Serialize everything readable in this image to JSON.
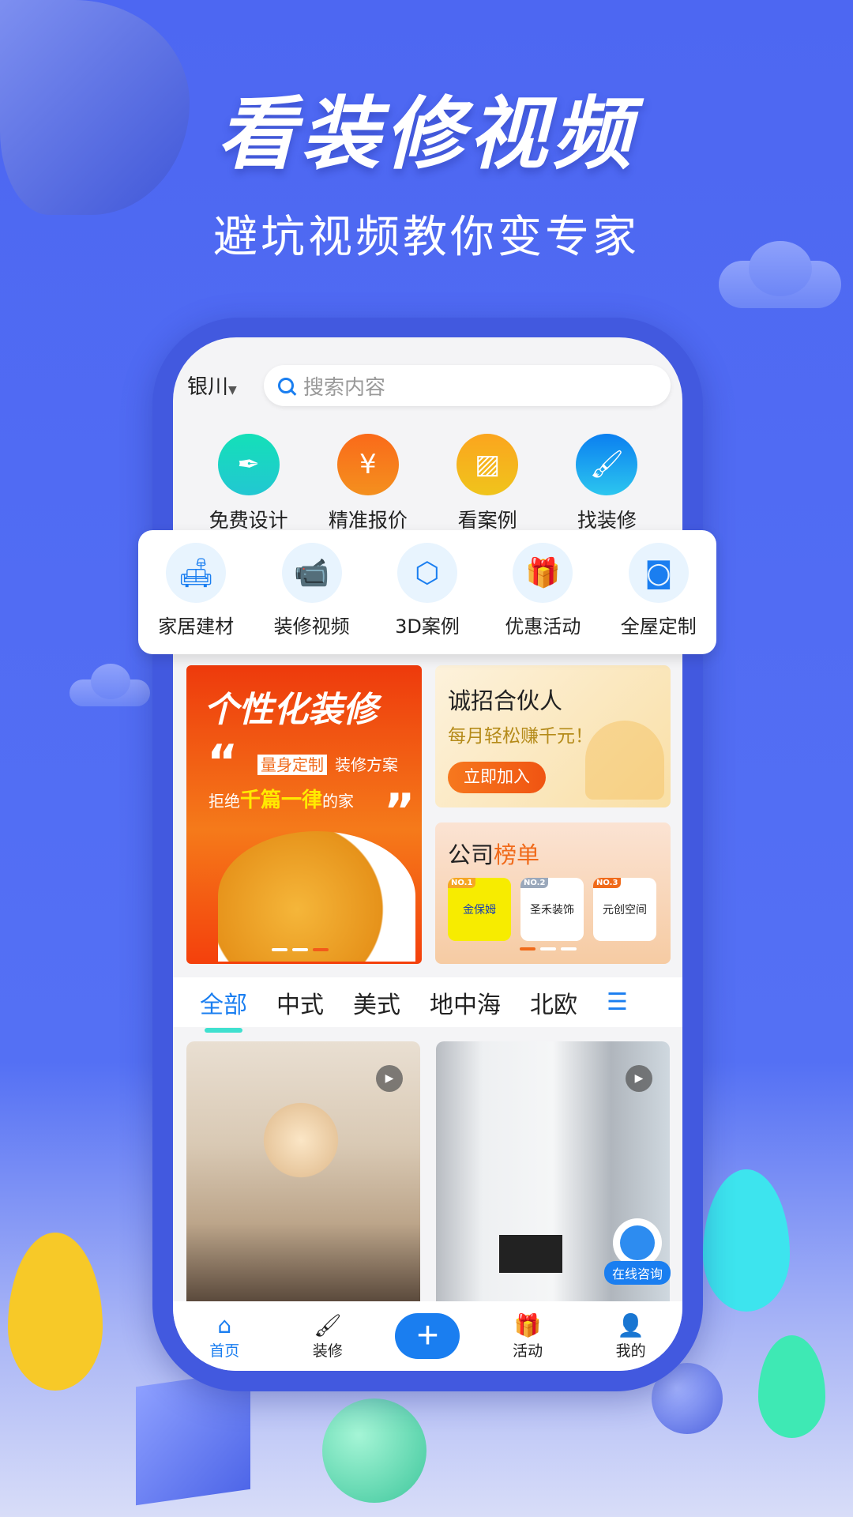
{
  "promo": {
    "headline": "看装修视频",
    "subline": "避坑视频教你变专家"
  },
  "header": {
    "city": "银川",
    "search_placeholder": "搜索内容"
  },
  "quick_actions": [
    {
      "label": "免费设计",
      "icon": "pen-icon",
      "color": "#1ed6be"
    },
    {
      "label": "精准报价",
      "icon": "price-jar-icon",
      "color": "#f67a1c"
    },
    {
      "label": "看案例",
      "icon": "picture-icon",
      "color": "#f7b21a"
    },
    {
      "label": "找装修",
      "icon": "paint-roller-icon",
      "color": "#1a8cf0"
    }
  ],
  "categories": [
    {
      "label": "家居建材",
      "icon": "sofa-icon"
    },
    {
      "label": "装修视频",
      "icon": "video-camera-icon"
    },
    {
      "label": "3D案例",
      "icon": "cube-icon"
    },
    {
      "label": "优惠活动",
      "icon": "gift-icon"
    },
    {
      "label": "全屋定制",
      "icon": "tape-measure-icon"
    }
  ],
  "banner_left": {
    "title": "个性化装修",
    "highlight": "量身定制",
    "line1": "装修方案",
    "line2_prefix": "拒绝",
    "line2_em": "千篇一律",
    "line2_suffix": "的家"
  },
  "banner_partner": {
    "title": "诚招合伙人",
    "subtitle": "每月轻松赚千元！",
    "button": "立即加入"
  },
  "banner_ranking": {
    "title_a": "公司",
    "title_b": "榜单",
    "companies": [
      {
        "rank": "NO.1",
        "name": "金保姆",
        "rank_color": "#f5a623"
      },
      {
        "rank": "NO.2",
        "name": "圣禾装饰",
        "rank_color": "#9aa8bb"
      },
      {
        "rank": "NO.3",
        "name": "元创空间",
        "rank_color": "#f06a1a"
      }
    ]
  },
  "style_tabs": [
    "全部",
    "中式",
    "美式",
    "地中海",
    "北欧"
  ],
  "active_tab": "全部",
  "consult": {
    "label": "在线咨询"
  },
  "bottom_nav": [
    {
      "label": "首页",
      "icon": "home-icon",
      "active": true
    },
    {
      "label": "装修",
      "icon": "paint-roller-icon"
    },
    {
      "label": "",
      "icon": "plus-icon"
    },
    {
      "label": "活动",
      "icon": "gift-icon"
    },
    {
      "label": "我的",
      "icon": "user-icon"
    }
  ],
  "colors": {
    "background": "#4d67f2",
    "accent": "#1a7ef0",
    "tab_indicator": "#3fe0cf"
  }
}
